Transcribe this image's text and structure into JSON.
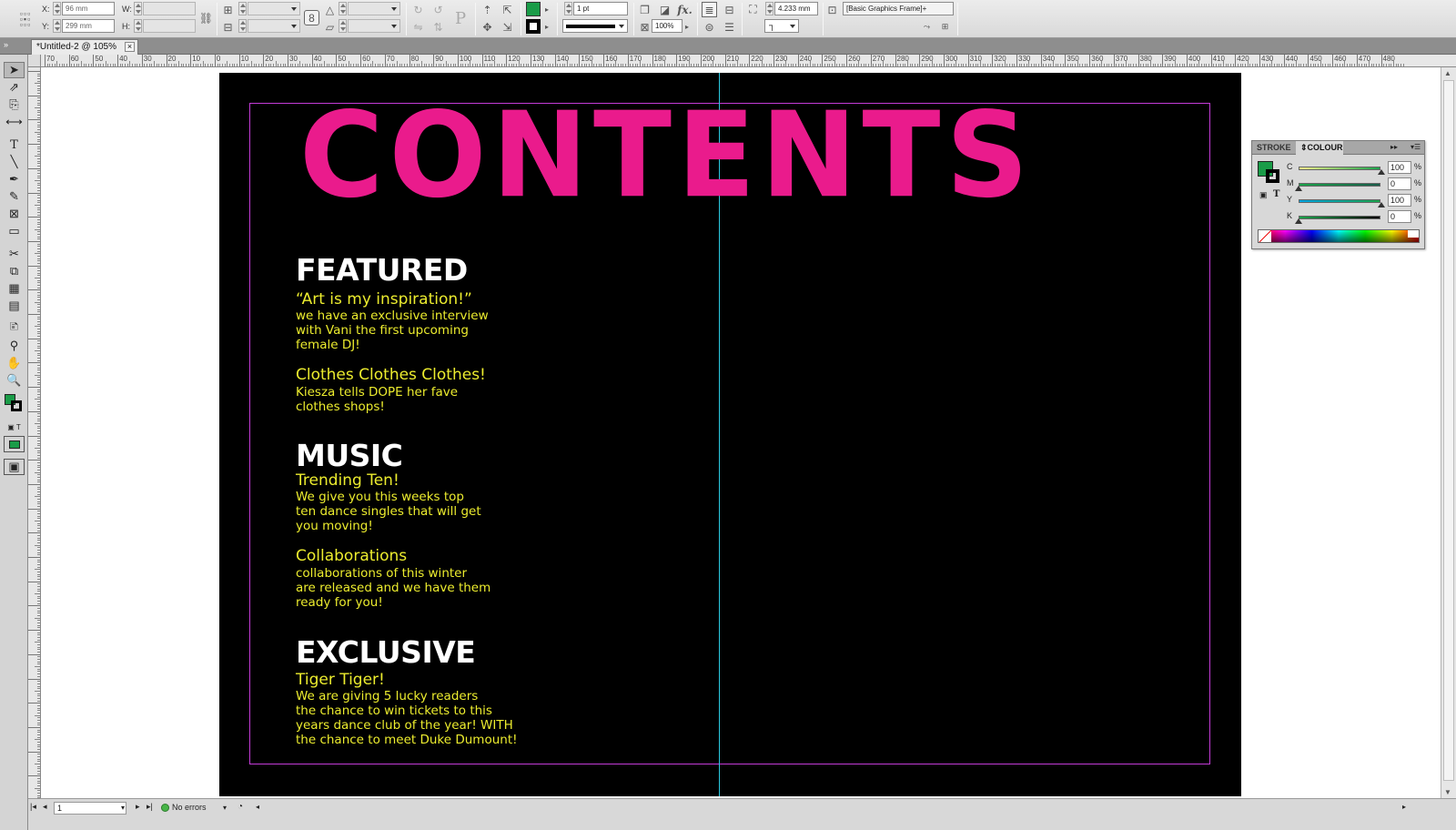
{
  "control_bar": {
    "x_label": "X:",
    "x_value": "96 mm",
    "y_label": "Y:",
    "y_value": "299 mm",
    "w_label": "W:",
    "h_label": "H:",
    "stroke_weight": "1 pt",
    "opacity": "100%",
    "dimension_value": "4.233 mm",
    "object_style": "[Basic Graphics Frame]+",
    "fill_color": "#1a9c48",
    "stroke_color": "#000000"
  },
  "document": {
    "tab_title": "*Untitled-2 @ 105%"
  },
  "rulers": {
    "h_labels": [
      "70",
      "60",
      "50",
      "40",
      "30",
      "20",
      "10",
      "0",
      "10",
      "20",
      "30",
      "40",
      "50",
      "60",
      "70",
      "80",
      "90",
      "100",
      "110",
      "120",
      "130",
      "140",
      "150",
      "160",
      "170",
      "180",
      "190",
      "200",
      "210",
      "220",
      "230",
      "240",
      "250",
      "260",
      "270",
      "280",
      "290",
      "300",
      "310",
      "320",
      "330",
      "340",
      "350",
      "360",
      "370",
      "380",
      "390",
      "400",
      "410",
      "420",
      "430",
      "440",
      "450",
      "460",
      "470",
      "480"
    ]
  },
  "spread": {
    "title": "CONTENTS",
    "colors": {
      "background": "#000000",
      "title": "#ea1b8c",
      "heading": "#ffffff",
      "text": "#ecec2e",
      "margin_guide": "#c33bd7",
      "spine_guide": "#2bc8e0"
    },
    "sections": [
      {
        "heading": "FEATURED",
        "articles": [
          {
            "title": "“Art is my inspiration!”",
            "body": "we have an exclusive interview\nwith Vani the first upcoming\nfemale DJ!"
          },
          {
            "title": "Clothes Clothes Clothes!",
            "body": "Kiesza tells DOPE her fave\nclothes shops!"
          }
        ]
      },
      {
        "heading": "MUSIC",
        "articles": [
          {
            "title": "Trending Ten!",
            "body": "We give you this weeks top\nten dance singles that will get\nyou moving!"
          },
          {
            "title": "Collaborations",
            "body": "collaborations of this winter\nare released and we have them\nready for you!"
          }
        ]
      },
      {
        "heading": "EXCLUSIVE",
        "articles": [
          {
            "title": "Tiger Tiger!",
            "body": "We are giving 5 lucky readers\nthe chance to win tickets to this\nyears dance club of the year! WITH\nthe chance to meet Duke Dumount!"
          }
        ]
      }
    ]
  },
  "colour_panel": {
    "tab_stroke": "STROKE",
    "tab_colour": "COLOUR",
    "fill_swatch": "#1a9c48",
    "sliders": [
      {
        "label": "C",
        "value": "100",
        "pct": "%",
        "level": 1.0,
        "gradient": "linear-gradient(to right,#ffffff,#00a3e0)"
      },
      {
        "label": "M",
        "value": "0",
        "pct": "%",
        "level": 0.0,
        "gradient": "linear-gradient(to right,#1aa34a,#8a2a6e)"
      },
      {
        "label": "Y",
        "value": "100",
        "pct": "%",
        "level": 1.0,
        "gradient": "linear-gradient(to right,#00a3e0,#10a84a)"
      },
      {
        "label": "K",
        "value": "0",
        "pct": "%",
        "level": 0.0,
        "gradient": "linear-gradient(to right,#1aa34a,#000000)"
      }
    ]
  },
  "status_bar": {
    "page_number": "1",
    "preflight": "No errors"
  }
}
